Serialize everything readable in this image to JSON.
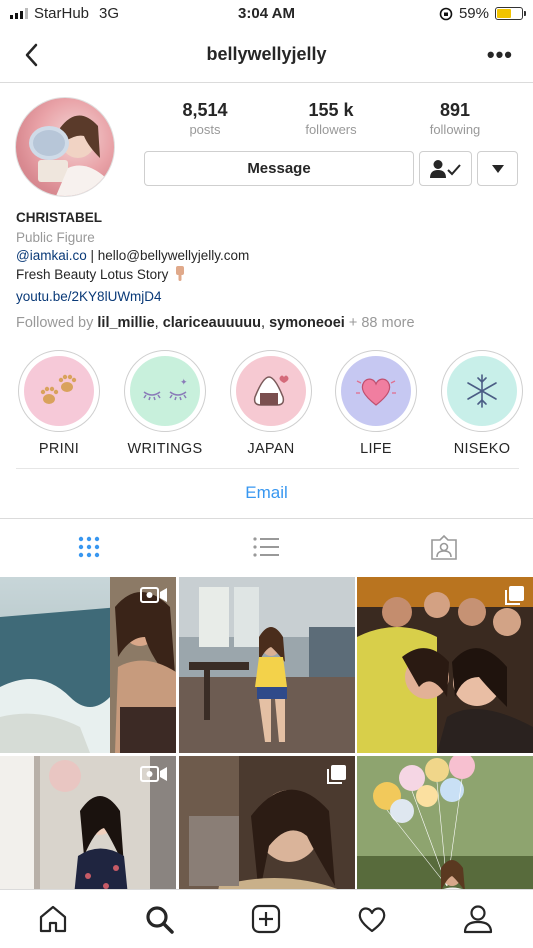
{
  "status_bar": {
    "carrier": "StarHub",
    "network": "3G",
    "time": "3:04 AM",
    "battery": "59%",
    "battery_level": 0.59
  },
  "nav": {
    "username": "bellywellyjelly",
    "back_icon": "chevron-left-icon",
    "more_icon": "ellipsis-icon"
  },
  "stats": [
    {
      "value": "8,514",
      "label": "posts"
    },
    {
      "value": "155 k",
      "label": "followers"
    },
    {
      "value": "891",
      "label": "following"
    }
  ],
  "actions": {
    "message": "Message",
    "follow_icon": "person-check-icon",
    "dropdown_icon": "caret-down-icon"
  },
  "bio": {
    "name": "CHRISTABEL",
    "category": "Public Figure",
    "handle": "@iamkai.co",
    "contact": " | hello@bellywellyjelly.com",
    "tagline": "Fresh Beauty Lotus Story",
    "link": "youtu.be/2KY8lUWmjD4",
    "followed_by_label": "Followed by ",
    "followed_by_users": [
      "lil_millie",
      "clariceauuuuu",
      "symoneoei"
    ],
    "followed_by_more": "+ 88 more"
  },
  "highlights": [
    {
      "label": "PRINI",
      "bg": "#f6c9d8",
      "icon": "paw-icon"
    },
    {
      "label": "WRITINGS",
      "bg": "#c8f0dc",
      "icon": "eyes-closed-icon"
    },
    {
      "label": "JAPAN",
      "bg": "#f6c9d2",
      "icon": "onigiri-icon"
    },
    {
      "label": "LIFE",
      "bg": "#c6c8f2",
      "icon": "heart-icon"
    },
    {
      "label": "NISEKO",
      "bg": "#c8efe9",
      "icon": "snowflake-icon"
    }
  ],
  "email_button": "Email",
  "tabs": [
    {
      "name": "grid-view",
      "icon": "grid-icon",
      "active": true
    },
    {
      "name": "list-view",
      "icon": "list-icon",
      "active": false
    },
    {
      "name": "tagged",
      "icon": "tagged-icon",
      "active": false
    }
  ],
  "posts": [
    {
      "desc": "seaside photo",
      "badge": "camera-icon"
    },
    {
      "desc": "cafe photo",
      "badge": ""
    },
    {
      "desc": "group party photo",
      "badge": "multi-icon"
    },
    {
      "desc": "mirror photo",
      "badge": "camera-icon"
    },
    {
      "desc": "close-up photo",
      "badge": "multi-icon"
    },
    {
      "desc": "balloons photo",
      "badge": ""
    }
  ],
  "bottom_nav": [
    {
      "name": "home",
      "icon": "home-icon"
    },
    {
      "name": "search",
      "icon": "search-icon"
    },
    {
      "name": "new-post",
      "icon": "plus-square-icon"
    },
    {
      "name": "activity",
      "icon": "heart-outline-icon"
    },
    {
      "name": "profile",
      "icon": "person-icon"
    }
  ]
}
